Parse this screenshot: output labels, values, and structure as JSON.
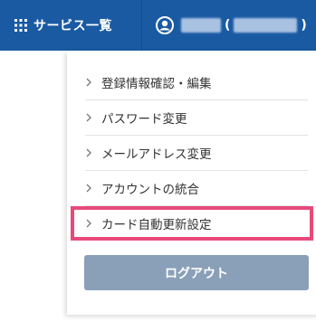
{
  "header": {
    "service_list_label": "サービス一覧",
    "service_icon": "grid-icon",
    "user_icon": "user-circle-icon",
    "paren_open": "(",
    "paren_close": ")"
  },
  "menu": {
    "items": [
      {
        "label": "登録情報確認・編集"
      },
      {
        "label": "パスワード変更"
      },
      {
        "label": "メールアドレス変更"
      },
      {
        "label": "アカウントの統合"
      },
      {
        "label": "カード自動更新設定"
      }
    ],
    "highlight_color": "#e8497a"
  },
  "logout": {
    "label": "ログアウト"
  },
  "colors": {
    "header_bg": "#1a5aa3",
    "logout_bg": "#8aa0b9"
  }
}
